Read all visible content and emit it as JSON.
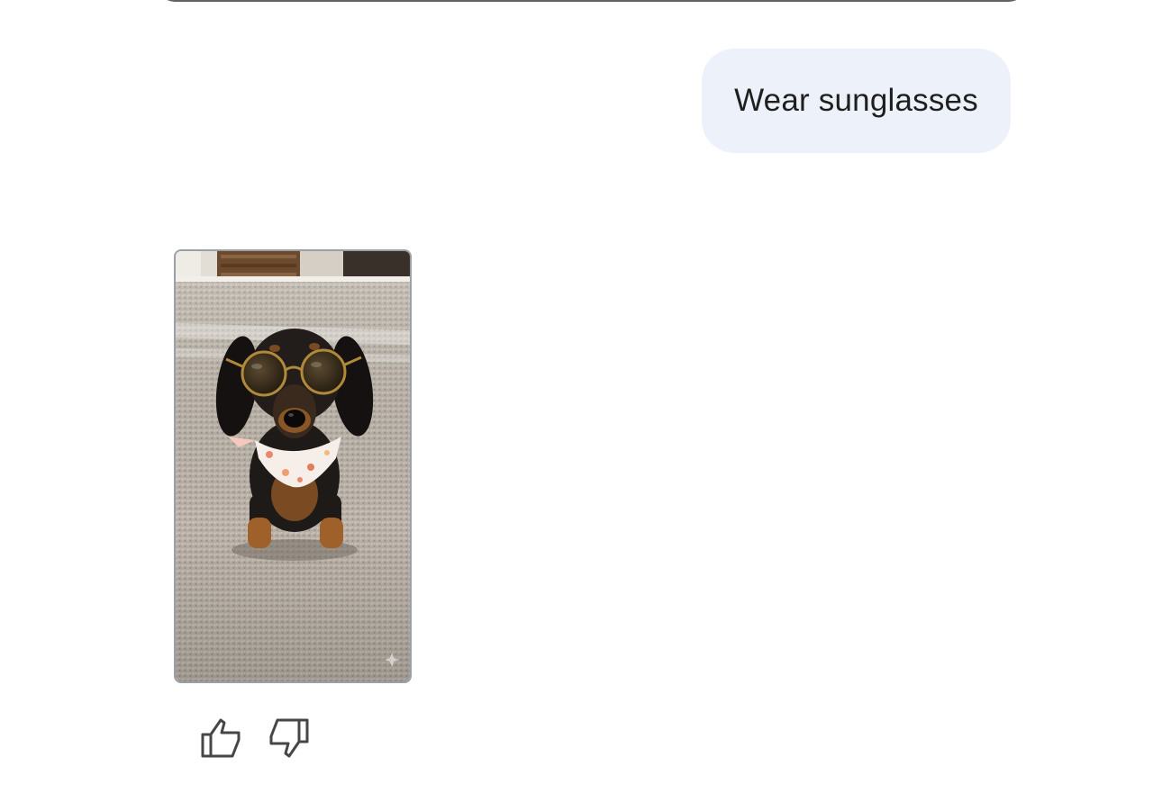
{
  "conversation": {
    "user_message": {
      "text": "Wear sunglasses"
    },
    "response": {
      "image": {
        "subject": "dachshund-wearing-sunglasses-and-floral-bandana",
        "alt": ""
      },
      "feedback": {
        "thumbs_up_icon": "thumbs-up-icon",
        "thumbs_down_icon": "thumbs-down-icon"
      }
    }
  },
  "colors": {
    "bubble_bg": "#edf2fa",
    "text": "#1f1f1f",
    "icon": "#444746"
  }
}
